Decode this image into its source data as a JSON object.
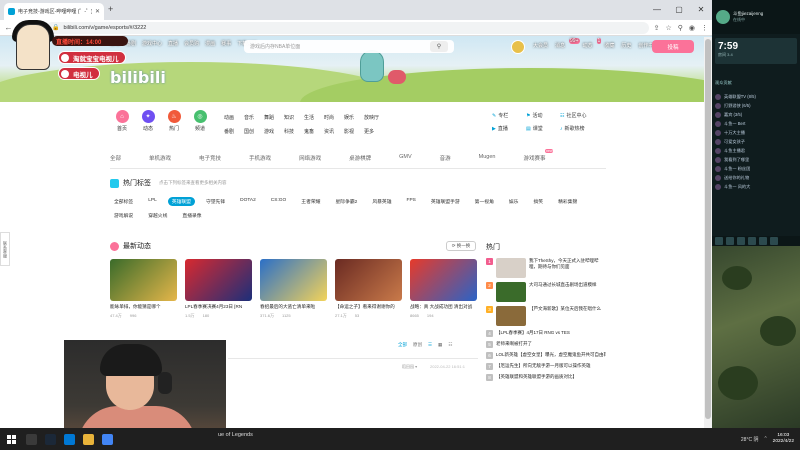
{
  "browser": {
    "tab_title": "电子竞技-游戏区-哔哩哔哩 (゜-゜)",
    "url": "bilibili.com/v/game/esports/#/3222"
  },
  "header": {
    "top_nav": [
      "主站",
      "番剧",
      "游戏中心",
      "直播",
      "会员购",
      "漫画",
      "赛事",
      "下载APP"
    ],
    "search_placeholder": "游戏后内存NBA单位面",
    "user_menu": [
      {
        "label": "大会员",
        "badge": ""
      },
      {
        "label": "消息",
        "badge": "99+"
      },
      {
        "label": "动态",
        "badge": "1"
      },
      {
        "label": "收藏",
        "badge": ""
      },
      {
        "label": "历史",
        "badge": ""
      },
      {
        "label": "创作中心",
        "badge": ""
      }
    ],
    "upload_label": "投稿"
  },
  "overlay": {
    "timer": "直播时间：14:00",
    "pill1": "淘就宝宝电视儿",
    "pill2": "电视儿"
  },
  "category": {
    "big_icons": [
      {
        "label": "首页",
        "color": "#fb7299"
      },
      {
        "label": "动态",
        "color": "#6f4ff2"
      },
      {
        "label": "热门",
        "color": "#f15a3a"
      },
      {
        "label": "频道",
        "color": "#47c06f"
      }
    ],
    "grid": [
      "动画",
      "音乐",
      "舞蹈",
      "知识",
      "生活",
      "时尚",
      "娱乐",
      "放映厅",
      "",
      "",
      "",
      "番剧",
      "国创",
      "游戏",
      "科技",
      "鬼畜",
      "资讯",
      "影视",
      "更多",
      "",
      "",
      ""
    ],
    "side_links": [
      {
        "icon": "✎",
        "label": "专栏"
      },
      {
        "icon": "⚑",
        "label": "活动"
      },
      {
        "icon": "☷",
        "label": "社区中心"
      },
      {
        "icon": "▶",
        "label": "直播"
      },
      {
        "icon": "▤",
        "label": "课堂"
      },
      {
        "icon": "♪",
        "label": "新歌热榜"
      }
    ]
  },
  "subtabs": [
    {
      "label": "全部",
      "active": false,
      "new": ""
    },
    {
      "label": "单机游戏",
      "active": false,
      "new": ""
    },
    {
      "label": "电子竞技",
      "active": true,
      "new": ""
    },
    {
      "label": "手机游戏",
      "active": false,
      "new": ""
    },
    {
      "label": "网络游戏",
      "active": false,
      "new": ""
    },
    {
      "label": "桌游棋牌",
      "active": false,
      "new": ""
    },
    {
      "label": "GMV",
      "active": false,
      "new": ""
    },
    {
      "label": "音游",
      "active": false,
      "new": ""
    },
    {
      "label": "Mugen",
      "active": false,
      "new": ""
    },
    {
      "label": "游戏赛事",
      "active": false,
      "new": "new"
    }
  ],
  "hot_tags": {
    "title": "热门标签",
    "subtitle": "点击下列标签来查看更多相关内容",
    "tags": [
      {
        "label": "全部标签",
        "on": false
      },
      {
        "label": "LPL",
        "on": false
      },
      {
        "label": "英雄联盟",
        "on": true
      },
      {
        "label": "守望先锋",
        "on": false
      },
      {
        "label": "DOTA2",
        "on": false
      },
      {
        "label": "CS:GO",
        "on": false
      },
      {
        "label": "王者荣耀",
        "on": false
      },
      {
        "label": "星际争霸2",
        "on": false
      },
      {
        "label": "风暴英雄",
        "on": false
      },
      {
        "label": "FPS",
        "on": false
      },
      {
        "label": "英雄联盟手游",
        "on": false
      },
      {
        "label": "第一视角",
        "on": false
      },
      {
        "label": "娱乐",
        "on": false
      },
      {
        "label": "搞笑",
        "on": false
      },
      {
        "label": "精彩集锦",
        "on": false
      },
      {
        "label": "游戏解说",
        "on": false
      },
      {
        "label": "穿越火线",
        "on": false
      },
      {
        "label": "直播录像",
        "on": false
      }
    ]
  },
  "latest": {
    "title": "最新动态",
    "refresh_label": "换一换",
    "cards": [
      {
        "title": "能咏单排，你能猜是哪个",
        "plays": "47.4万",
        "danmaku": "996",
        "c1": "#3a6b2a",
        "c2": "#e5b64a"
      },
      {
        "title": "LPL春季赛决赛4月23日 [RN",
        "plays": "1.5万",
        "danmaku": "180",
        "c1": "#d8292f",
        "c2": "#1c2f7a"
      },
      {
        "title": "春招最后的大逃亡清单来啦",
        "plays": "371.6万",
        "danmaku": "1125",
        "c1": "#2b6fc7",
        "c2": "#f3d35a"
      },
      {
        "title": "【命运之子】看来得谢谢你的",
        "plays": "27.1万",
        "danmaku": "53",
        "c1": "#6a2a22",
        "c2": "#c97a4a"
      },
      {
        "title": "战略：真 大战成功团 清出对战",
        "plays": "8665",
        "danmaku": "194",
        "c1": "#e73a2a",
        "c2": "#2a63c7"
      }
    ]
  },
  "hot": {
    "title": "热门",
    "items": [
      {
        "rank": "1",
        "text": "我下TheShy，今天正式入驻哔哩哔哩，期待与你们见面",
        "thumb": true,
        "color": "#d8d0c8"
      },
      {
        "rank": "2",
        "text": "大司马通过长城直击剧场出道模样",
        "thumb": true,
        "color": "#3a6b2a"
      },
      {
        "rank": "3",
        "text": "【芦文海新歌】某位天后我在唱什么",
        "thumb": true,
        "color": "#8a6a3a"
      },
      {
        "rank": "4",
        "text": "【LPL春季赛】4月17日 RNG vs TES",
        "thumb": false,
        "color": ""
      },
      {
        "rank": "5",
        "text": "老师来啊被打开了",
        "thumb": false,
        "color": ""
      },
      {
        "rank": "6",
        "text": "LOL新英雄【虚空女皇】曝光，虚空魔鬼鱼开共可自由转生你打野真魂",
        "thumb": false,
        "color": ""
      },
      {
        "rank": "7",
        "text": "【厄运先生】所向无敌手游一月版可以操作英雄",
        "thumb": false,
        "color": ""
      },
      {
        "rank": "8",
        "text": "【英雄联盟和英雄联盟手游的画质对比】",
        "thumb": false,
        "color": ""
      }
    ]
  },
  "list_filter": {
    "items": [
      {
        "label": "全部",
        "on": true
      },
      {
        "label": "原创",
        "on": false
      },
      {
        "label": "☰",
        "on": true
      },
      {
        "label": "▦",
        "on": false
      },
      {
        "label": "☷",
        "on": false
      }
    ],
    "meta_left": "稻田园 ▾",
    "meta_right": "2022-04-22 16:51:1"
  },
  "sidenote": "联系客服",
  "right_panel": {
    "name": "斗鱼jiezaijenng",
    "sub": "在线中",
    "time": "7:59",
    "small1": "房间 3.4",
    "section1": "观众贡献",
    "list": [
      "英雄联盟TV (8/5)",
      "打野游侠 (6/5)",
      "嘉宾 (3/5)",
      "斗鱼一 Bert",
      "十万大主播",
      "可爱女孩子",
      "斗鱼主播君",
      "我看到了哪里",
      "斗鱼一 粉丝团",
      "送给你的礼物",
      "斗鱼一 风的大"
    ]
  },
  "taskbar": {
    "app_label": "ue of Legends",
    "weather": "28°C 阴",
    "time": "16:03",
    "date": "2022/4/22"
  }
}
